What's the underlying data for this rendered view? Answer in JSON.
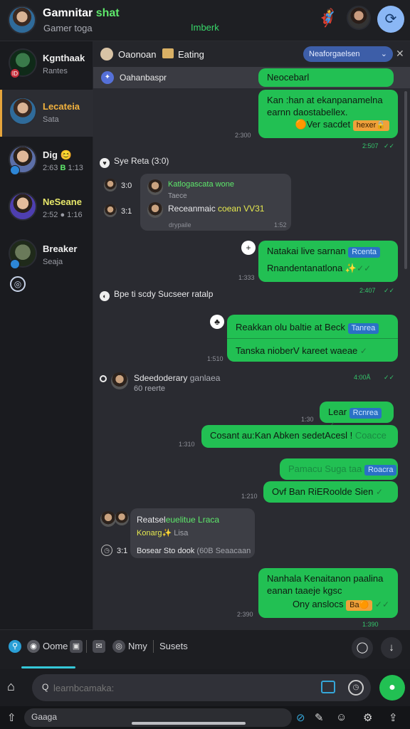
{
  "header": {
    "title_main": "Gamnitar ",
    "title_accent": "shat",
    "subtitle": "Gamer toga",
    "center_label": "Imberk"
  },
  "sidebar": {
    "items": [
      {
        "name": "Kgnthaak",
        "sub": "Rantes",
        "badge": "ID"
      },
      {
        "name": "Lecateia",
        "sub": "Sata"
      },
      {
        "name": "Dig 😊",
        "sub_prefix": "2:63 ",
        "sub_accent": "B",
        "sub_suffix": " 1:13"
      },
      {
        "name": "NeSeane",
        "sub": "2:52 ● 1:16"
      },
      {
        "name": "Breaker",
        "sub": "Seaja"
      }
    ]
  },
  "chat_header": {
    "peer_name": "Oaonoan",
    "status": "Eating",
    "pill_label": "Neaforgaelsen",
    "pinned_text": "Oahanbaspr"
  },
  "messages": {
    "m1": "Neocebarl",
    "m2_line1": "Kan :han at ekanpanamelna",
    "m2_line2": "earnn daostabellex.",
    "m2_line3": "🟠Ver sacdet",
    "m2_tag": "hexer🔒",
    "m2_time_left": "2:300",
    "m2_time_right": "2:507",
    "sys1": "Sye Reta (3:0)",
    "in1_t1": "3:0",
    "in1_t2": "3:1",
    "in1_title": "Katlogascata",
    "in1_title2": "wone",
    "in1_sub": "Taece",
    "in1_line": "Receanmaic",
    "in1_line_accent": "coean VV31",
    "in1_foot_left": "drypaile",
    "in1_foot_right": "1:52",
    "m3_line1": "Natakai live sarnan",
    "m3_tag": "Rcenta",
    "m3_line2": "Rnandentanatlona",
    "m3_time_left": "1:333",
    "m3_time_right": "2:407",
    "sys2": "Bpe ti scdy Sucseer ratalp",
    "m4_line1": "Reakkan olu baltie at Beck",
    "m4_tag": "Tanrea",
    "m4_line2": "Tanska nioberV kareet waeae",
    "m4_time_left": "1:510",
    "m4_time_right": "4:00Å",
    "sys3_name": "Sdeedoderary",
    "sys3_name2": "ganlaea",
    "sys3_sub": "60 reerte",
    "m5_text": "Lear",
    "m5_tag": "Rcnrea",
    "m5_time": "1:30",
    "m6_text": "Cosant au:Kan Abken sedetAcesl !",
    "m6_suffix": "Coacce",
    "m6_time": "1:310",
    "m7_text": "Pamacu Suga taa",
    "m7_tag": "Roacra",
    "m8_text": "Ovf Ban RiERoolde Sien",
    "m8_time": "1:210",
    "in2_name": "Reatsel",
    "in2_name_accent": "euelitue Lraca",
    "in2_tag": "Konarg✨",
    "in2_tag2": "Lisa",
    "in2_t1": "3:1",
    "in2_foot": "Bosear Sto dook",
    "in2_foot2": "(60B Seaacaan",
    "m9_line1": "Nanhala  Kenaitanon paalina",
    "m9_line2": "eanan taaeje kgsc",
    "m9_line3": "Ony anslocs",
    "m9_tag": "Ba🟠",
    "m9_time_left": "2:390",
    "m9_time_right": "1:390"
  },
  "tabs": {
    "t1": "Oome",
    "t3": "Nmy",
    "t4": "Susets"
  },
  "input": {
    "placeholder": "learnbcamaka:"
  },
  "bottombar": {
    "label": "Gaaga"
  },
  "colors": {
    "outgoing": "#22c053",
    "incoming": "#3d3e45",
    "accent_blue": "#2a71c5",
    "tab_underline": "#35c8d8"
  }
}
